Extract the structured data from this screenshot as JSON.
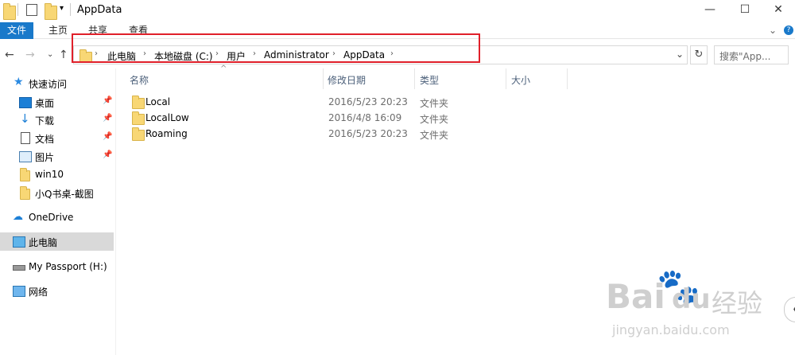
{
  "window": {
    "title": "AppData"
  },
  "window_controls": {
    "minimize": "—",
    "maximize": "☐",
    "close": "✕"
  },
  "ribbon": {
    "tabs": [
      "文件",
      "主页",
      "共享",
      "查看"
    ],
    "expand": "⌄",
    "help": "?"
  },
  "nav_buttons": {
    "back": "←",
    "forward": "→",
    "recent": "⌄",
    "up": "↑"
  },
  "address": {
    "crumbs": [
      "此电脑",
      "本地磁盘 (C:)",
      "用户",
      "Administrator",
      "AppData"
    ],
    "dropdown": "⌄",
    "refresh": "↻"
  },
  "search": {
    "placeholder": "搜索\"App..."
  },
  "navigation_pane": {
    "items": [
      {
        "label": "快速访问",
        "icon": "star-icon"
      },
      {
        "label": "桌面",
        "icon": "desktop-icon",
        "pinned": true
      },
      {
        "label": "下载",
        "icon": "download-icon",
        "pinned": true
      },
      {
        "label": "文档",
        "icon": "document-icon",
        "pinned": true
      },
      {
        "label": "图片",
        "icon": "picture-icon",
        "pinned": true
      },
      {
        "label": "win10",
        "icon": "folder-icon"
      },
      {
        "label": "小Q书桌-截图",
        "icon": "folder-icon"
      },
      {
        "label": "OneDrive",
        "icon": "cloud-icon"
      },
      {
        "label": "此电脑",
        "icon": "computer-icon",
        "selected": true
      },
      {
        "label": "My Passport (H:)",
        "icon": "drive-icon"
      },
      {
        "label": "网络",
        "icon": "network-icon"
      }
    ]
  },
  "columns": {
    "name": "名称",
    "date": "修改日期",
    "type": "类型",
    "size": "大小"
  },
  "files": [
    {
      "name": "Local",
      "date": "2016/5/23 20:23",
      "type": "文件夹"
    },
    {
      "name": "LocalLow",
      "date": "2016/4/8 16:09",
      "type": "文件夹"
    },
    {
      "name": "Roaming",
      "date": "2016/5/23 20:23",
      "type": "文件夹"
    }
  ],
  "watermark": {
    "brand": "Bai",
    "brand2": "du",
    "cn": "经验",
    "url": "jingyan.baidu.com"
  },
  "colors": {
    "accent": "#1979ca",
    "highlight_box": "#e0202a",
    "folder": "#f8d775",
    "selected": "#d9d9d9"
  }
}
